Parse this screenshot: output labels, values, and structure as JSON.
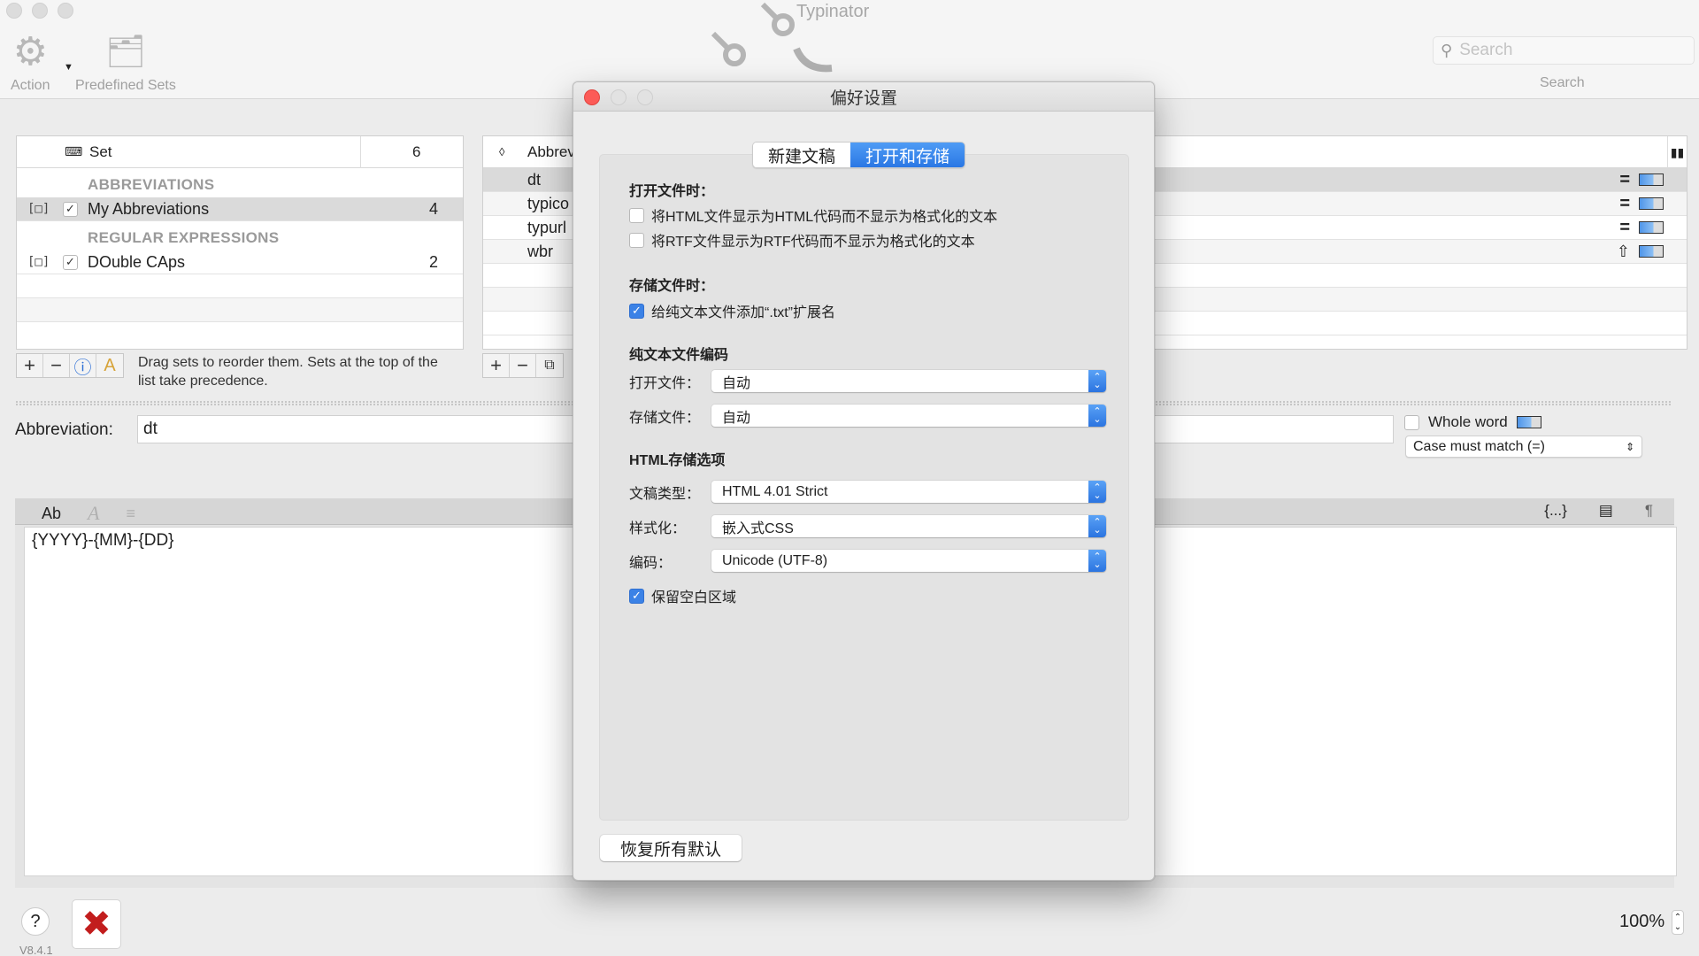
{
  "window": {
    "title": "Typinator"
  },
  "toolbar": {
    "action_label": "Action",
    "predefined_label": "Predefined Sets",
    "search_placeholder": "Search",
    "search_label": "Search"
  },
  "sets": {
    "header_set": "Set",
    "header_count": "6",
    "sections": [
      {
        "title": "ABBREVIATIONS",
        "items": [
          {
            "name": "My Abbreviations",
            "count": "4",
            "enabled": true,
            "selected": true
          }
        ]
      },
      {
        "title": "REGULAR EXPRESSIONS",
        "items": [
          {
            "name": "DOuble CAps",
            "count": "2",
            "enabled": true,
            "selected": false
          }
        ]
      }
    ],
    "hint": "Drag sets to reorder them. Sets at the top of the list take precedence."
  },
  "abbreviations": {
    "header_sort": "◊",
    "header_abbr": "Abbreviation",
    "rows": [
      {
        "abbr": "dt",
        "mode": "=",
        "selected": true
      },
      {
        "abbr": "typico",
        "mode": "=",
        "selected": false
      },
      {
        "abbr": "typurl",
        "mode": "=",
        "selected": false
      },
      {
        "abbr": "wbr",
        "mode": "⇧",
        "selected": false
      }
    ]
  },
  "detail": {
    "abbreviation_label": "Abbreviation:",
    "abbreviation_value": "dt",
    "whole_word_label": "Whole word",
    "whole_word_checked": false,
    "case_option": "Case must match (=)",
    "editor_tabs": [
      "Ab",
      "A",
      "≡"
    ],
    "editor_tools": [
      "{...}",
      "▤",
      "¶"
    ],
    "expansion": "{YYYY}-{MM}-{DD}"
  },
  "footer": {
    "help": "?",
    "version": "V8.4.1",
    "zoom": "100%"
  },
  "prefs": {
    "title": "偏好设置",
    "tabs": [
      {
        "label": "新建文稿",
        "active": false
      },
      {
        "label": "打开和存储",
        "active": true
      }
    ],
    "open_heading": "打开文件时：",
    "open_opts": [
      {
        "label": "将HTML文件显示为HTML代码而不显示为格式化的文本",
        "checked": false
      },
      {
        "label": "将RTF文件显示为RTF代码而不显示为格式化的文本",
        "checked": false
      }
    ],
    "save_heading": "存储文件时：",
    "save_opts": [
      {
        "label": "给纯文本文件添加“.txt”扩展名",
        "checked": true
      }
    ],
    "encoding_heading": "纯文本文件编码",
    "encoding_fields": [
      {
        "label": "打开文件：",
        "value": "自动"
      },
      {
        "label": "存储文件：",
        "value": "自动"
      }
    ],
    "html_heading": "HTML存储选项",
    "html_fields": [
      {
        "label": "文稿类型：",
        "value": "HTML 4.01 Strict"
      },
      {
        "label": "样式化：",
        "value": "嵌入式CSS"
      },
      {
        "label": "编码：",
        "value": "Unicode (UTF-8)"
      }
    ],
    "html_opts": [
      {
        "label": "保留空白区域",
        "checked": true
      }
    ],
    "restore_label": "恢复所有默认"
  },
  "colors": {
    "accent": "#2f7de6",
    "close": "#fc5b57",
    "quit": "#c21d1d"
  }
}
